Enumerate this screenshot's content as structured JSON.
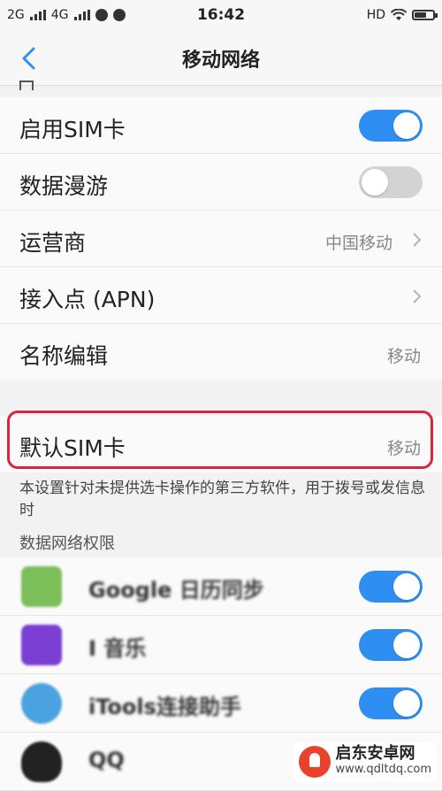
{
  "status_bar": {
    "network1": "2G",
    "network2": "4G",
    "time": "16:42",
    "hd": "HD"
  },
  "header": {
    "title": "移动网络",
    "back_icon": "chevron-left-icon"
  },
  "settings": {
    "rows": [
      {
        "label": "启用SIM卡",
        "type": "toggle",
        "on": true
      },
      {
        "label": "数据漫游",
        "type": "toggle",
        "on": false
      },
      {
        "label": "运营商",
        "value": "中国移动",
        "type": "link"
      },
      {
        "label": "接入点 (APN)",
        "value": "",
        "type": "link"
      },
      {
        "label": "名称编辑",
        "value": "移动",
        "type": "value"
      }
    ]
  },
  "default_sim": {
    "label": "默认SIM卡",
    "value": "移动"
  },
  "hint": "本设置针对未提供选卡操作的第三方软件，用于拨号或发信息时",
  "data_permissions": {
    "title": "数据网络权限",
    "apps": [
      {
        "name": "Google 日历同步",
        "on": true,
        "icon_color": "#7cbf5a"
      },
      {
        "name": "I 音乐",
        "on": true,
        "icon_color": "#7b3fd4"
      },
      {
        "name": "iTools连接助手",
        "on": true,
        "icon_color": "#4aa3df"
      },
      {
        "name": "QQ",
        "on": false,
        "icon_color": "#222222"
      }
    ]
  },
  "watermark": {
    "title": "启东安卓网",
    "url": "www.qdltdq.com"
  },
  "colors": {
    "accent": "#2f8ef2",
    "highlight": "#d7263d"
  }
}
